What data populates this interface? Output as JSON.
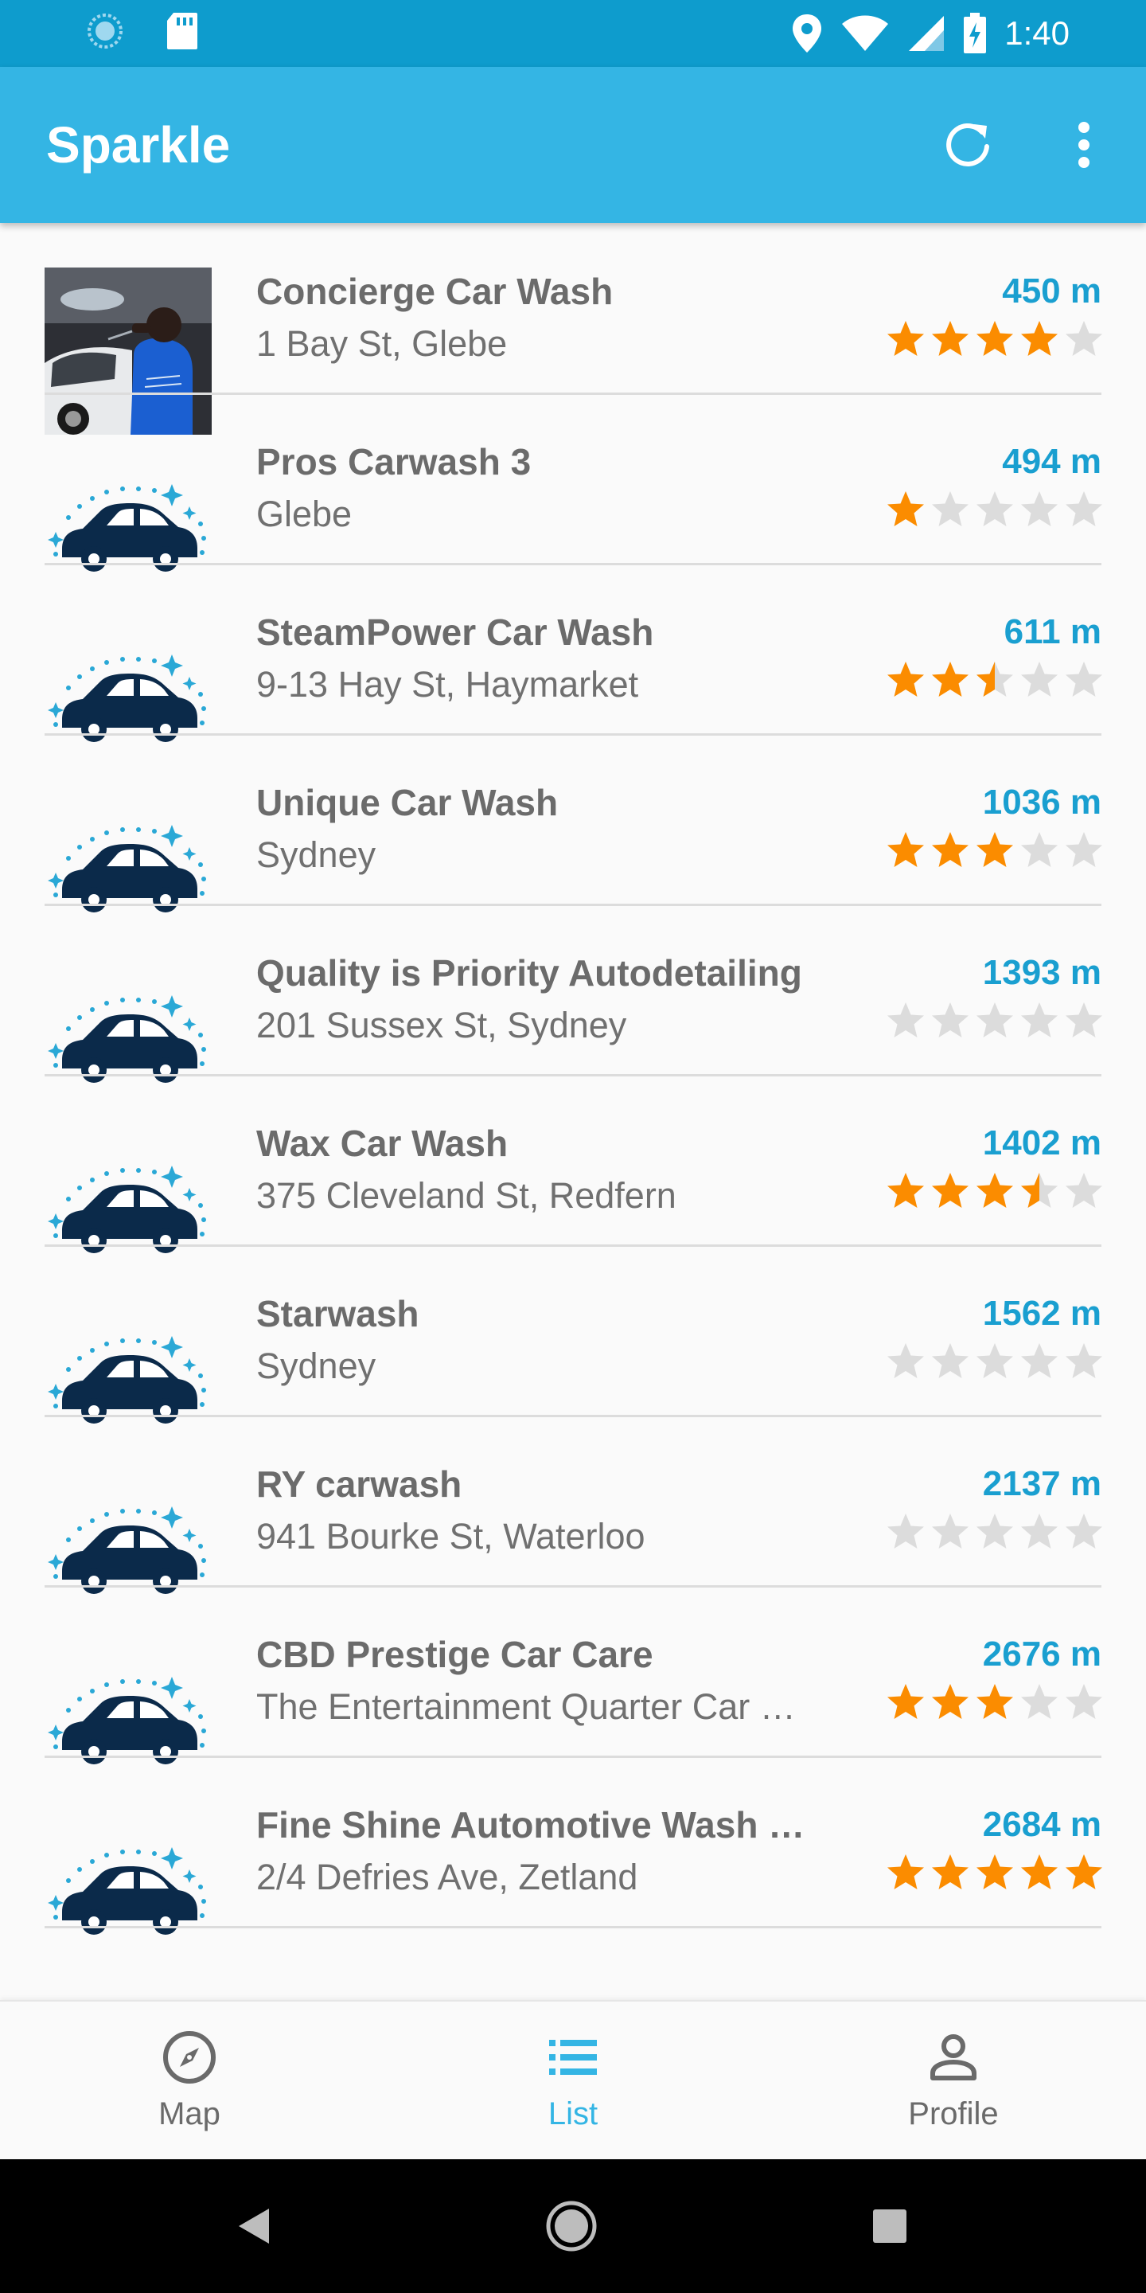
{
  "status_bar": {
    "time": "1:40",
    "icons_left": [
      "sync-icon",
      "sd-card-icon"
    ],
    "icons_right": [
      "location-icon",
      "wifi-icon",
      "signal-icon",
      "battery-charging-icon"
    ]
  },
  "app_bar": {
    "title": "Sparkle",
    "actions": [
      "refresh-icon",
      "more-vert-icon"
    ]
  },
  "colors": {
    "status_bar": "#0e9ccd",
    "app_bar": "#34b5e4",
    "accent": "#1a9fd0",
    "star_filled": "#fb8c00",
    "star_empty": "#dcdcdc",
    "car_icon": "#0b2a4a"
  },
  "list": {
    "items": [
      {
        "name": "Concierge Car Wash",
        "address": "1 Bay St, Glebe",
        "distance": "450 m",
        "rating": 4,
        "image": "photo"
      },
      {
        "name": "Pros Carwash 3",
        "address": "Glebe",
        "distance": "494 m",
        "rating": 1,
        "image": "car-icon"
      },
      {
        "name": "SteamPower Car Wash",
        "address": "9-13 Hay St, Haymarket",
        "distance": "611 m",
        "rating": 2.5,
        "image": "car-icon"
      },
      {
        "name": "Unique Car Wash",
        "address": "Sydney",
        "distance": "1036 m",
        "rating": 3,
        "image": "car-icon"
      },
      {
        "name": "Quality is Priority Autodetailing",
        "address": "201 Sussex St, Sydney",
        "distance": "1393 m",
        "rating": 0,
        "image": "car-icon"
      },
      {
        "name": "Wax Car Wash",
        "address": "375 Cleveland St, Redfern",
        "distance": "1402 m",
        "rating": 3.5,
        "image": "car-icon"
      },
      {
        "name": "Starwash",
        "address": "Sydney",
        "distance": "1562 m",
        "rating": 0,
        "image": "car-icon"
      },
      {
        "name": "RY carwash",
        "address": "941 Bourke St, Waterloo",
        "distance": "2137 m",
        "rating": 0,
        "image": "car-icon"
      },
      {
        "name": "CBD Prestige Car Care",
        "address": "The Entertainment Quarter Car …",
        "distance": "2676 m",
        "rating": 3,
        "image": "car-icon"
      },
      {
        "name": "Fine Shine Automotive Wash a…",
        "address": "2/4 Defries Ave, Zetland",
        "distance": "2684 m",
        "rating": 5,
        "image": "car-icon"
      }
    ]
  },
  "bottom_nav": {
    "items": [
      {
        "label": "Map",
        "icon": "compass-icon",
        "active": false
      },
      {
        "label": "List",
        "icon": "list-icon",
        "active": true
      },
      {
        "label": "Profile",
        "icon": "person-icon",
        "active": false
      }
    ]
  },
  "system_nav": [
    "back-icon",
    "home-icon",
    "recents-icon"
  ]
}
